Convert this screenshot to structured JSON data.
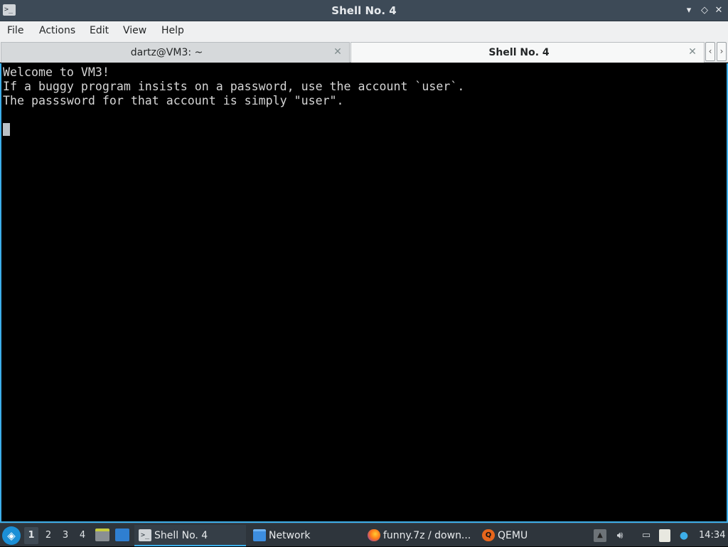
{
  "window": {
    "title": "Shell No. 4",
    "minimize_glyph": "▾",
    "maximize_glyph": "◇",
    "close_glyph": "✕",
    "icon": "terminal-icon"
  },
  "menu": {
    "file": "File",
    "actions": "Actions",
    "edit": "Edit",
    "view": "View",
    "help": "Help"
  },
  "tabs": [
    {
      "label": "dartz@VM3: ~",
      "active": false
    },
    {
      "label": "Shell No. 4",
      "active": true
    }
  ],
  "tab_close_glyph": "✕",
  "tab_scroll": {
    "left": "‹",
    "right": "›"
  },
  "terminal": {
    "lines": [
      "Welcome to VM3!",
      "If a buggy program insists on a password, use the account `user`.",
      "The passsword for that account is simply \"user\"."
    ]
  },
  "taskbar": {
    "workspaces": [
      "1",
      "2",
      "3",
      "4"
    ],
    "current_workspace": "1",
    "tasks": [
      {
        "label": "Shell No. 4",
        "icon": "terminal-icon",
        "active": true
      },
      {
        "label": "Network",
        "icon": "folder-icon",
        "active": false
      },
      {
        "label": "funny.7z / down...",
        "icon": "firefox-icon",
        "active": false
      },
      {
        "label": "QEMU",
        "icon": "qemu-icon",
        "active": false
      }
    ],
    "clock": "14:34"
  },
  "colors": {
    "accent": "#3daee9",
    "terminal_bg": "#000000",
    "terminal_fg": "#d5d5d5",
    "titlebar": "#3d4a57",
    "taskbar": "#2e353c"
  }
}
